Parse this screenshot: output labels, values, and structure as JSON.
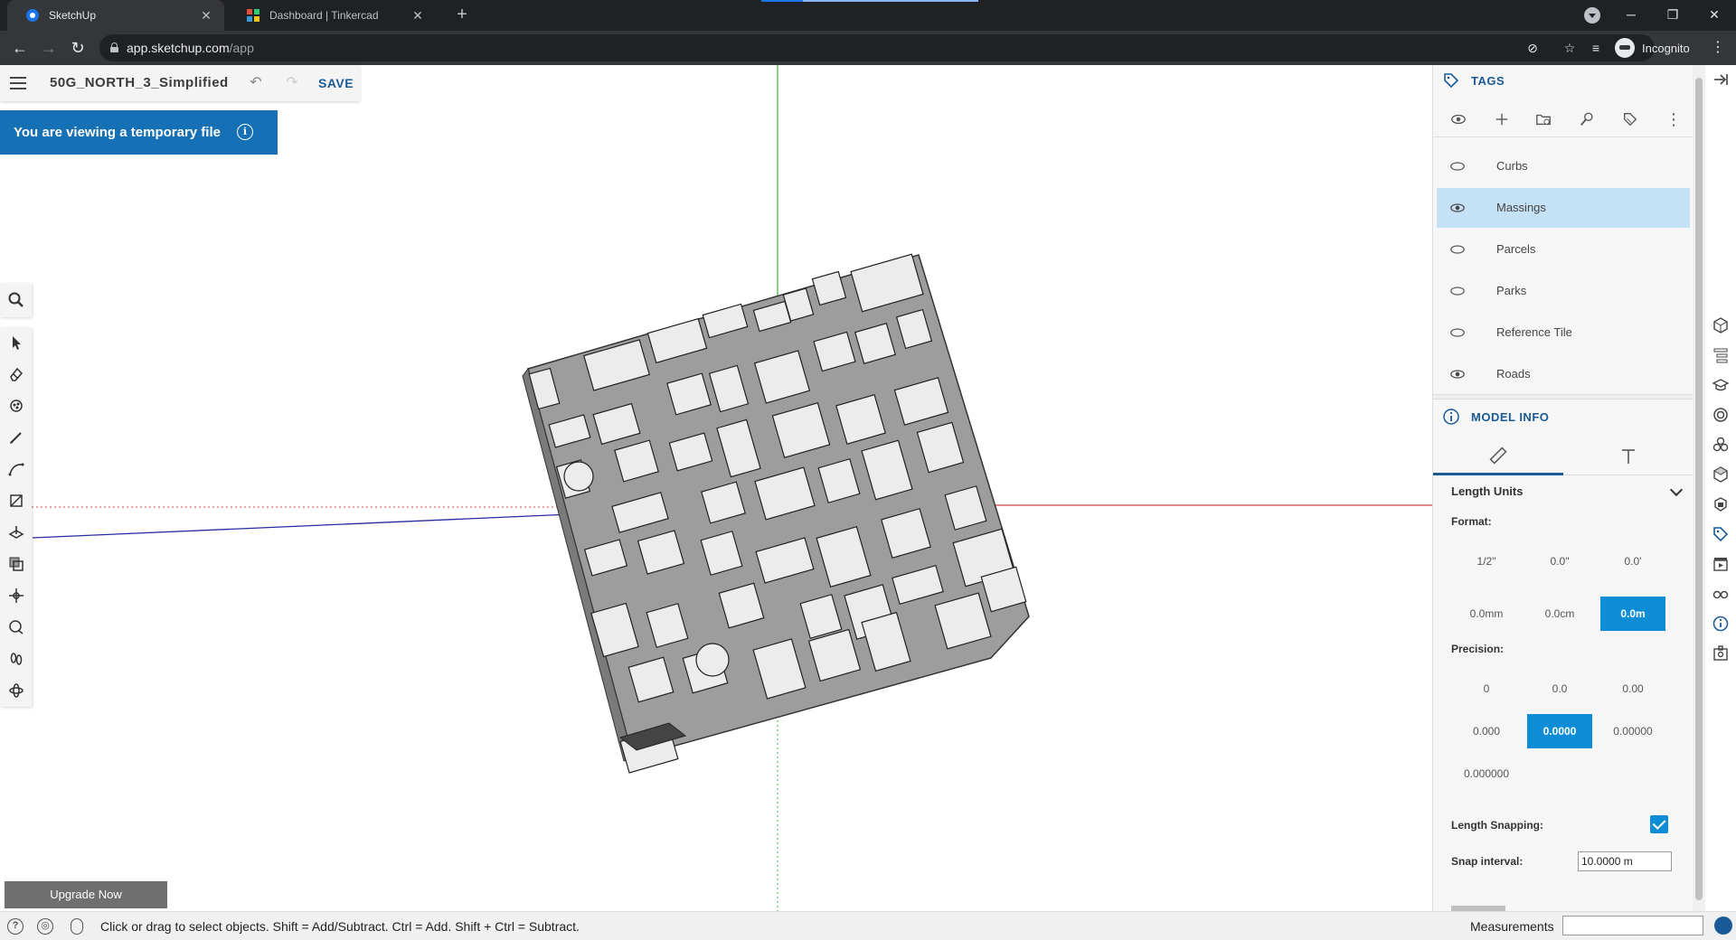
{
  "browser": {
    "tabs": [
      {
        "title": "SketchUp",
        "active": true
      },
      {
        "title": "Dashboard | Tinkercad",
        "active": false
      }
    ],
    "url_host": "app.sketchup.com",
    "url_path": "/app",
    "profile_label": "Incognito"
  },
  "header": {
    "file_title": "50G_NORTH_3_Simplified",
    "save_label": "SAVE"
  },
  "banner": {
    "text": "You are viewing a temporary file"
  },
  "upgrade_label": "Upgrade Now",
  "status": {
    "hint": "Click or drag to select objects. Shift = Add/Subtract. Ctrl = Add. Shift + Ctrl = Subtract.",
    "measurements_label": "Measurements",
    "measurements_value": ""
  },
  "tags_panel": {
    "title": "TAGS",
    "tags": [
      {
        "name": "Curbs",
        "visible": false,
        "selected": false
      },
      {
        "name": "Massings",
        "visible": true,
        "selected": true
      },
      {
        "name": "Parcels",
        "visible": false,
        "selected": false
      },
      {
        "name": "Parks",
        "visible": false,
        "selected": false
      },
      {
        "name": "Reference Tile",
        "visible": false,
        "selected": false
      },
      {
        "name": "Roads",
        "visible": true,
        "selected": false
      }
    ]
  },
  "model_info": {
    "title": "MODEL INFO",
    "length_units_label": "Length Units",
    "format_label": "Format:",
    "format_options": [
      "1/2\"",
      "0.0\"",
      "0.0'",
      "0.0mm",
      "0.0cm",
      "0.0m"
    ],
    "format_selected": "0.0m",
    "precision_label": "Precision:",
    "precision_options": [
      "0",
      "0.0",
      "0.00",
      "0.000",
      "0.0000",
      "0.00000",
      "0.000000"
    ],
    "precision_selected": "0.0000",
    "length_snapping_label": "Length Snapping:",
    "length_snapping": true,
    "snap_interval_label": "Snap interval:",
    "snap_interval_value": "10.0000 m"
  },
  "colors": {
    "accent": "#1a5a96",
    "selection": "#0d8dd6",
    "banner": "#1670b5",
    "tag_selected": "#c5e1f5"
  }
}
